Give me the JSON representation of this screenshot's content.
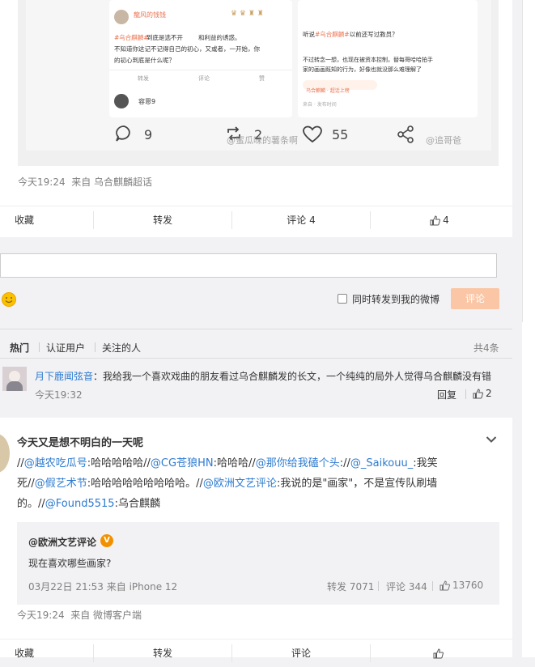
{
  "post1": {
    "embedded_image": {
      "card_left": {
        "username": "龍风的钱钱",
        "tag_text": "#乌合麒麟#",
        "body_line1": "到底是选不开",
        "body_line2": "和利益的诱惑。",
        "body_line3": "不知道你这记不记得自己的初心，又或者，一开始，你",
        "body_line4": "的初心到底是什么呢？",
        "actions": [
          "转发",
          "评论",
          "赞"
        ],
        "next_user": "容恩9"
      },
      "card_right": {
        "body_line1": "听说",
        "tag_text": "#乌合麒麟#",
        "body_line1b": "以前还写过教员？",
        "body_line2": "不过转念一想，也现在被资本控制，替每哥哈哈拍手",
        "body_line3": "家的画画既知的行为，好像也就没那么难理解了",
        "mini_label": "乌合麒麟 · 超话上榜",
        "mini_meta": "来自 · 发布时间"
      },
      "counts": {
        "comment": "9",
        "repost": "2",
        "like": "55"
      },
      "watermark1": "@蜜瓜味的薯条啊",
      "watermark2": "@追哥爸"
    },
    "meta": "今天19:24  来自 乌合麒麟超话",
    "actions": {
      "favorite": "收藏",
      "repost": "转发",
      "comment": "评论 4",
      "like": "4"
    }
  },
  "comment_box": {
    "input_value": "",
    "emoji_icon": "smile-icon",
    "sync_label": "同时转发到我的微博",
    "submit": "评论"
  },
  "comment_tabs": {
    "hot": "热门",
    "verified": "认证用户",
    "following": "关注的人",
    "total": "共4条"
  },
  "comments": [
    {
      "user": "月下鹿闻弦音",
      "text": "：我给我一个喜欢戏曲的朋友看过乌合麒麟发的长文，一个纯纯的局外人觉得乌合麒麟没有错",
      "time": "今天19:32",
      "reply": "回复",
      "likes": "2"
    }
  ],
  "post2": {
    "author": "今天又是想不明白的一天呢",
    "text": {
      "s1": "//",
      "m1": "@越农吃瓜号",
      "s2": ":哈哈哈哈哈//",
      "m2": "@CG苍狼HN",
      "s3": ":哈哈哈//",
      "m3": "@那你给我磕个头",
      "s4": ":",
      "s5": "//",
      "m4": "@_Saikouu_",
      "s6": ":我笑",
      "s7": "死//",
      "m5": "@假艺术节",
      "s8": ":哈哈哈哈哈哈哈哈哈。//",
      "m6": "@欧洲文艺评论",
      "s9": ":我说的是\"画家\"，不是宣传队刷墙",
      "s10": "的。//",
      "m7": "@Found5515",
      "s11": ":乌合麒麟"
    },
    "quoted": {
      "author": "@欧洲文艺评论",
      "badge": "V",
      "body": "现在喜欢哪些画家?",
      "meta": "03月22日 21:53 来自 iPhone 12",
      "repost": "转发 7071",
      "comment": "评论 344",
      "like": "13760"
    },
    "meta": "今天19:24  来自 微博客户端",
    "actions": {
      "favorite": "收藏",
      "repost": "转发",
      "comment": "评论",
      "like": ""
    }
  },
  "colors": {
    "link_orange": "#eb7350",
    "link_blue": "#2d7bd0",
    "submit_bg": "#fbc6a5",
    "vip_orange": "#f29100"
  }
}
